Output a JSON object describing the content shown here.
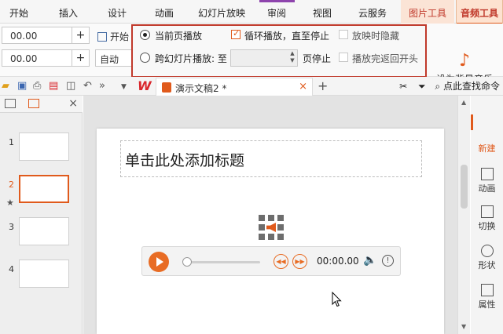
{
  "menu": {
    "tabs": [
      "开始",
      "插入",
      "设计",
      "动画",
      "幻灯片放映",
      "审阅",
      "视图",
      "云服务",
      "图片工具",
      "音频工具"
    ]
  },
  "ribbon": {
    "value1": "00.00",
    "value2": "00.00",
    "start_label": "开始",
    "auto_label": "自动",
    "options": {
      "current_page": "当前页播放",
      "cross_slides": "跨幻灯片播放: 至",
      "page_stop": "页停止",
      "loop": "循环播放，直至停止",
      "hide_when_playing": "放映时隐藏",
      "rewind": "播放完返回开头"
    },
    "bg_music": "设为背景音乐"
  },
  "doc": {
    "tab_title": "演示文稿2 *",
    "find_command": "点此查找命令"
  },
  "slides": {
    "numbers": [
      "1",
      "2",
      "3",
      "4"
    ],
    "selected": 2
  },
  "canvas": {
    "title_placeholder": "单击此处添加标题",
    "player_time": "00:00.00"
  },
  "right_rail": [
    "新建",
    "动画",
    "切换",
    "形状",
    "属性"
  ],
  "colors": {
    "accent": "#e05a1c",
    "highlight_box": "#c0392b"
  },
  "icons": {
    "play": "play-icon",
    "volume": "volume-icon",
    "info": "info-icon",
    "close": "close-icon",
    "music": "music-note-icon"
  }
}
